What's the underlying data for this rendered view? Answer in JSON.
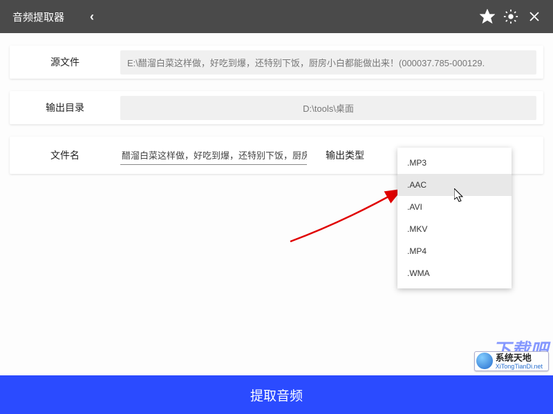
{
  "titlebar": {
    "title": "音频提取器",
    "back": "‹"
  },
  "source": {
    "label": "源文件",
    "value": "E:\\醋溜白菜这样做，好吃到爆，还特别下饭，厨房小白都能做出来！(000037.785-000129."
  },
  "output_dir": {
    "label": "输出目录",
    "value": "D:\\tools\\桌面"
  },
  "file": {
    "name_label": "文件名",
    "name_value": "醋溜白菜这样做，好吃到爆，还特别下饭，厨房小白",
    "type_label": "输出类型"
  },
  "dropdown": {
    "items": [
      ".MP3",
      ".AAC",
      ".AVI",
      ".MKV",
      ".MP4",
      ".WMA"
    ],
    "hover_index": 1
  },
  "extract_button": "提取音频",
  "watermark": {
    "back_text": "下载吧",
    "title": "系统天地",
    "url": "XiTongTianDi.net"
  }
}
